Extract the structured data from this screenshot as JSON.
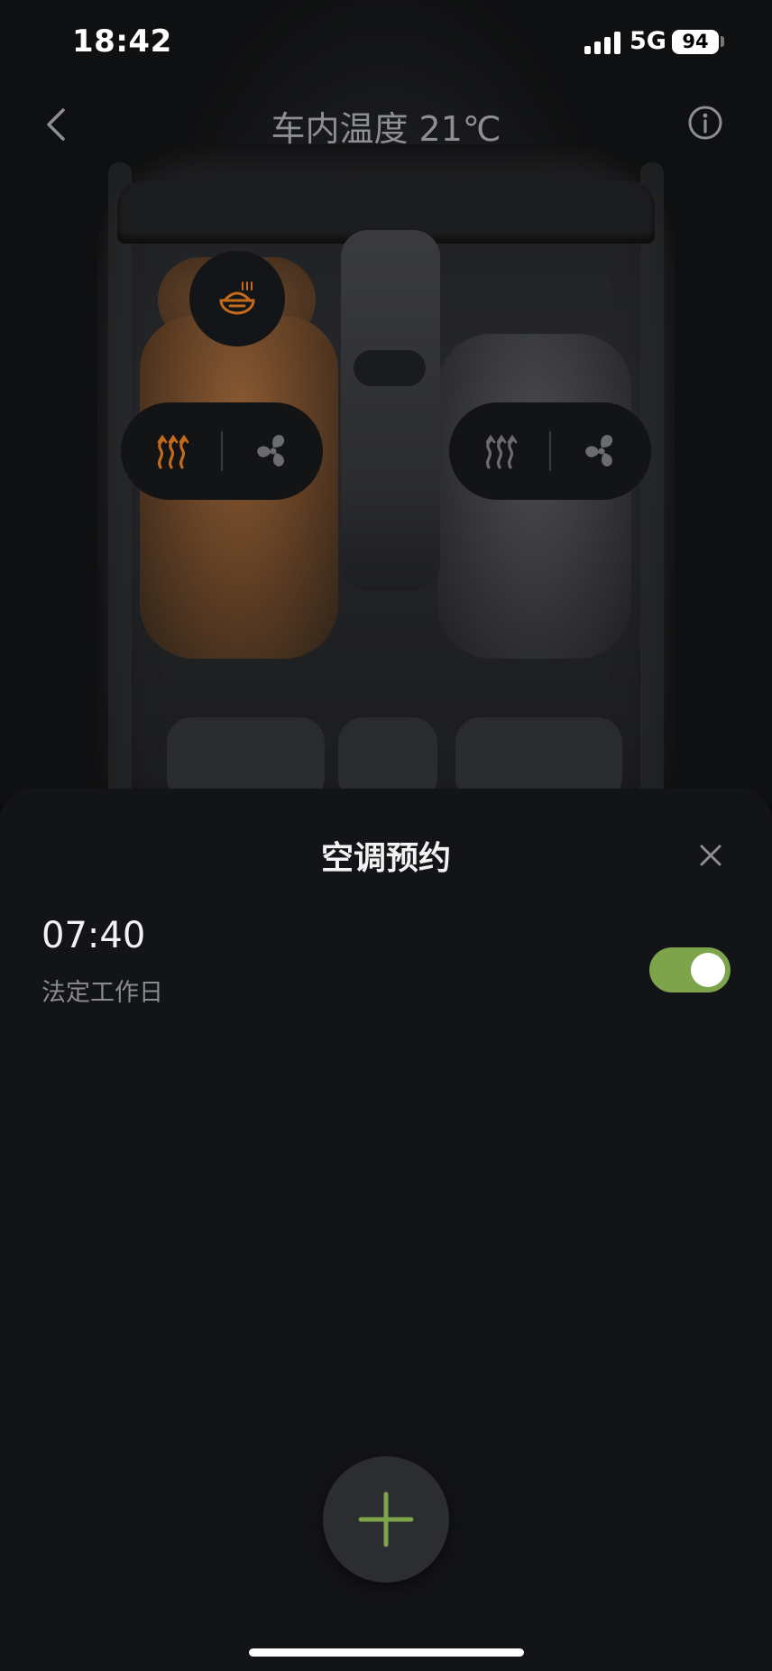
{
  "status_bar": {
    "time": "18:42",
    "network": "5G",
    "battery": "94"
  },
  "header": {
    "title": "车内温度 21℃",
    "back_icon": "chevron-left-icon",
    "info_icon": "info-circle-icon"
  },
  "car": {
    "driver_seat_color": "#8a5a33",
    "active_color": "#c56a1a",
    "inactive_color": "#6b6c70",
    "driver": {
      "heat_icon": "seat-heat-icon",
      "heat_active": true,
      "fan_icon": "fan-icon",
      "fan_active": false
    },
    "passenger": {
      "heat_icon": "seat-heat-icon",
      "heat_active": false,
      "fan_icon": "fan-icon",
      "fan_active": false
    },
    "steering_heat_icon": "steering-wheel-heat-icon"
  },
  "sheet": {
    "title": "空调预约",
    "close_icon": "close-icon",
    "schedules": [
      {
        "time": "07:40",
        "repeat": "法定工作日",
        "enabled": true
      }
    ],
    "accent_color": "#7da44a",
    "add_icon": "plus-icon"
  }
}
